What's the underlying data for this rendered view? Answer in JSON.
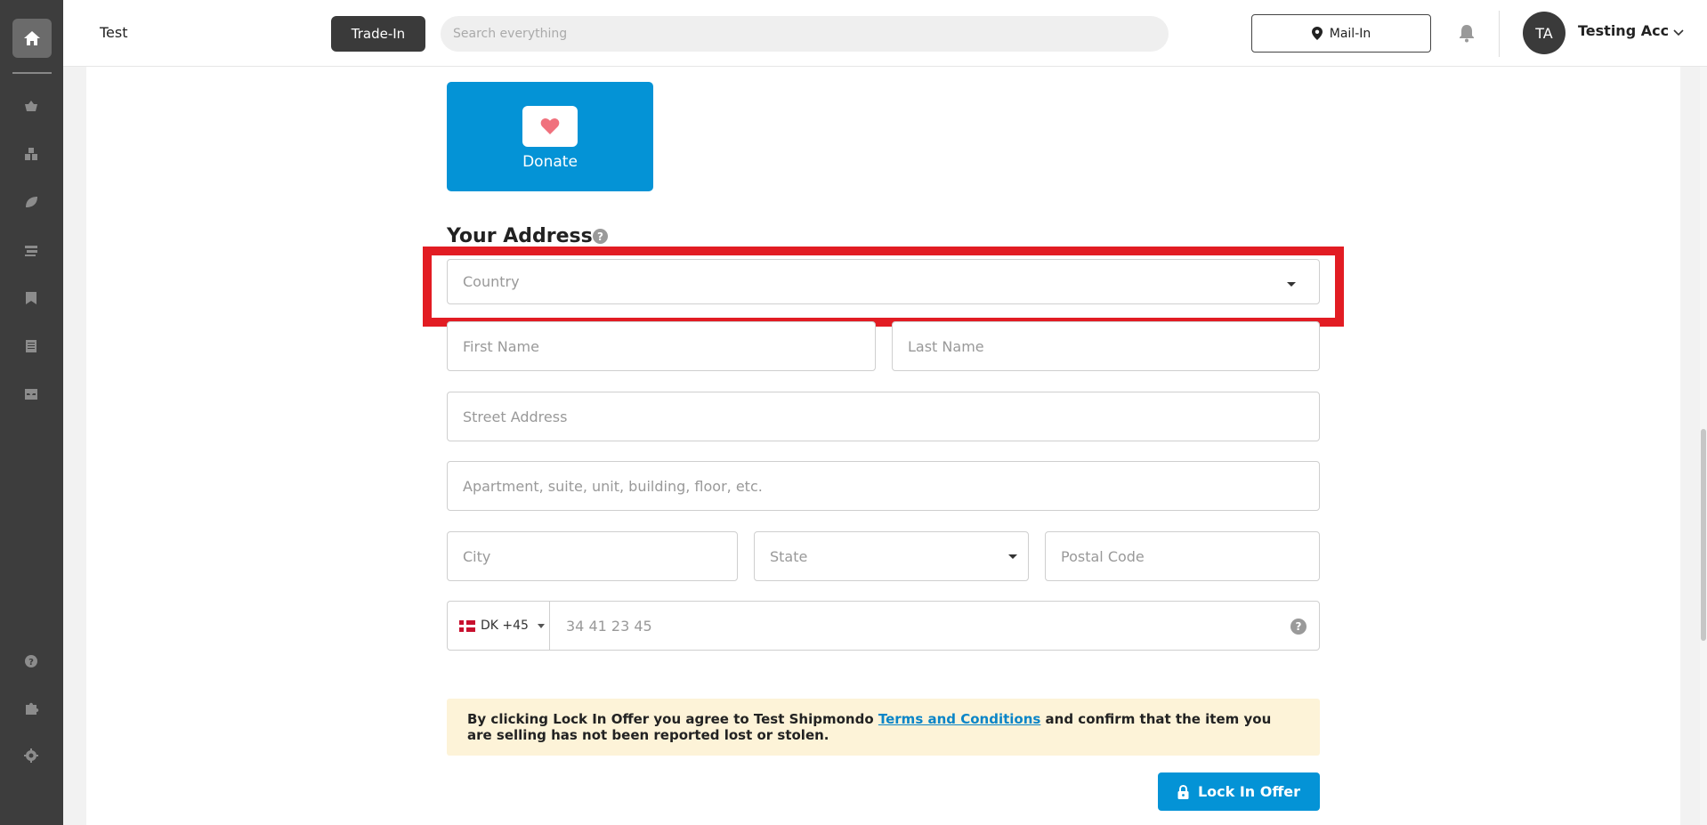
{
  "sidebar": {
    "home_icon": "home-icon",
    "items": [
      {
        "name": "basket-icon"
      },
      {
        "name": "boxes-icon"
      },
      {
        "name": "leaf-icon"
      },
      {
        "name": "shelves-icon"
      },
      {
        "name": "bookmark-icon"
      },
      {
        "name": "document-icon"
      },
      {
        "name": "inbox-icon"
      }
    ],
    "bottom_items": [
      {
        "name": "help-icon"
      },
      {
        "name": "puzzle-icon"
      },
      {
        "name": "gear-icon"
      }
    ]
  },
  "header": {
    "store_name": "Test",
    "tradein_label": "Trade-In",
    "search_placeholder": "Search everything",
    "mailin_label": "Mail-In",
    "avatar_initials": "TA",
    "user_name": "Testing Acc"
  },
  "donate": {
    "label": "Donate"
  },
  "address": {
    "title": "Your Address",
    "help_glyph": "?",
    "country_placeholder": "Country",
    "first_name_placeholder": "First Name",
    "last_name_placeholder": "Last Name",
    "street_placeholder": "Street Address",
    "apartment_placeholder": "Apartment, suite, unit, building, floor, etc.",
    "city_placeholder": "City",
    "state_placeholder": "State",
    "postal_placeholder": "Postal Code",
    "phone_country": "DK +45",
    "phone_placeholder": "34 41 23 45"
  },
  "notice": {
    "text_before": "By clicking Lock In Offer you agree to Test Shipmondo ",
    "link_text": "Terms and Conditions",
    "text_after": " and confirm that the item you are selling has not been reported lost or stolen."
  },
  "actions": {
    "lock_label": "Lock In Offer"
  },
  "colors": {
    "accent": "#0493d6",
    "highlight": "#e21c23",
    "notice_bg": "#fdf3d8",
    "sidebar_bg": "#3d3d3d"
  }
}
